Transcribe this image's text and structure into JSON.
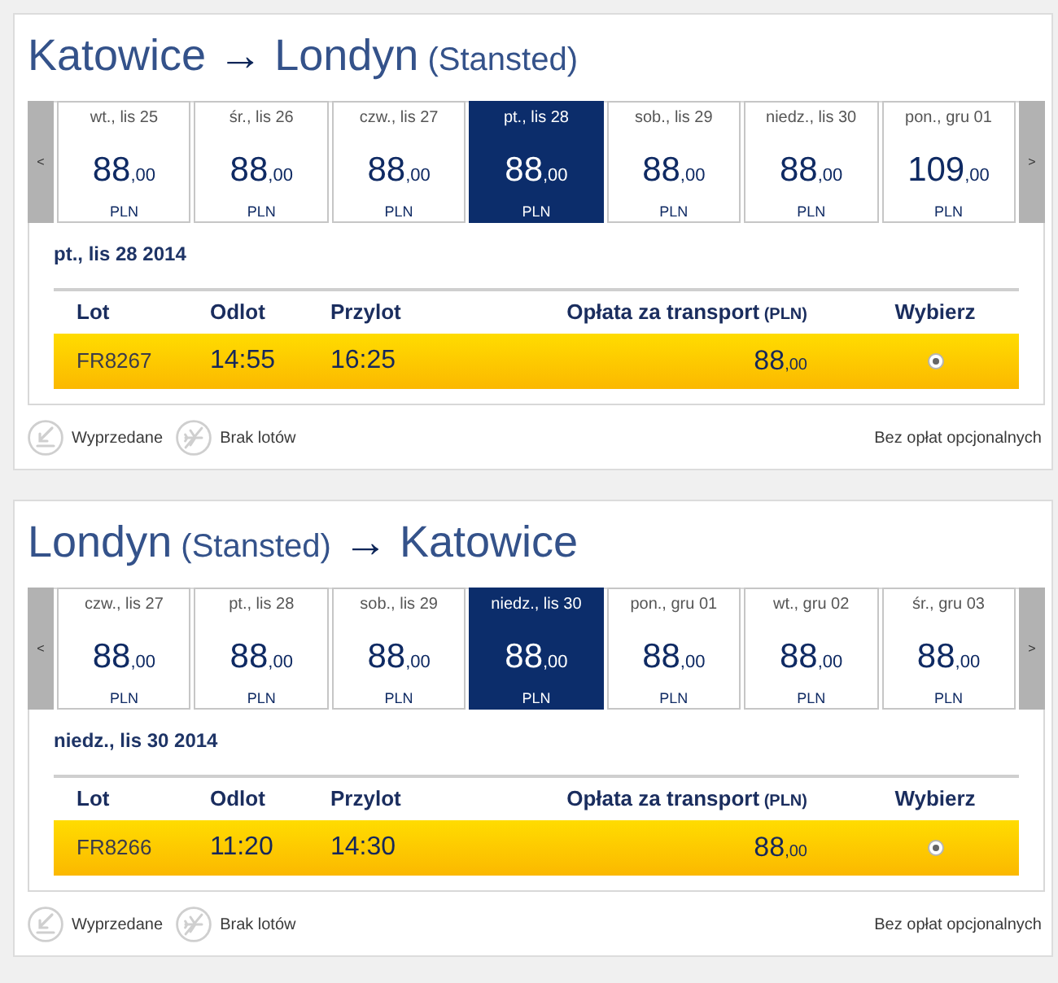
{
  "journeys": [
    {
      "title": [
        {
          "kind": "city",
          "text": "Katowice"
        },
        {
          "kind": "arrow",
          "text": "→"
        },
        {
          "kind": "city",
          "text": "Londyn"
        },
        {
          "kind": "airport",
          "text": "(Stansted)"
        }
      ],
      "prev_button": "<",
      "next_button": ">",
      "dates": [
        {
          "label": "wt., lis 25",
          "price": "88",
          "decimals": ",00",
          "currency": "PLN",
          "selected": false
        },
        {
          "label": "śr., lis 26",
          "price": "88",
          "decimals": ",00",
          "currency": "PLN",
          "selected": false
        },
        {
          "label": "czw., lis 27",
          "price": "88",
          "decimals": ",00",
          "currency": "PLN",
          "selected": false
        },
        {
          "label": "pt., lis 28",
          "price": "88",
          "decimals": ",00",
          "currency": "PLN",
          "selected": true
        },
        {
          "label": "sob., lis 29",
          "price": "88",
          "decimals": ",00",
          "currency": "PLN",
          "selected": false
        },
        {
          "label": "niedz., lis 30",
          "price": "88",
          "decimals": ",00",
          "currency": "PLN",
          "selected": false
        },
        {
          "label": "pon., gru 01",
          "price": "109",
          "decimals": ",00",
          "currency": "PLN",
          "selected": false
        }
      ],
      "selected_date": "pt., lis 28 2014",
      "columns": [
        {
          "label": "Lot"
        },
        {
          "label": "Odlot"
        },
        {
          "label": "Przylot"
        },
        {
          "label": "Opłata za transport",
          "unit": "(PLN)"
        },
        {
          "label": "Wybierz"
        }
      ],
      "rows": [
        {
          "flight": "FR8267",
          "departure": "14:55",
          "arrival": "16:25",
          "price": "88",
          "decimals": ",00",
          "selected": true
        }
      ],
      "legend": [
        {
          "kind": "soldout",
          "label": "Wyprzedane"
        },
        {
          "kind": "noflights",
          "label": "Brak lotów"
        }
      ],
      "note": "Bez opłat opcjonalnych"
    },
    {
      "title": [
        {
          "kind": "city",
          "text": "Londyn"
        },
        {
          "kind": "airport",
          "text": "(Stansted)"
        },
        {
          "kind": "arrow",
          "text": "→"
        },
        {
          "kind": "city",
          "text": "Katowice"
        }
      ],
      "prev_button": "<",
      "next_button": ">",
      "dates": [
        {
          "label": "czw., lis 27",
          "price": "88",
          "decimals": ",00",
          "currency": "PLN",
          "selected": false
        },
        {
          "label": "pt., lis 28",
          "price": "88",
          "decimals": ",00",
          "currency": "PLN",
          "selected": false
        },
        {
          "label": "sob., lis 29",
          "price": "88",
          "decimals": ",00",
          "currency": "PLN",
          "selected": false
        },
        {
          "label": "niedz., lis 30",
          "price": "88",
          "decimals": ",00",
          "currency": "PLN",
          "selected": true
        },
        {
          "label": "pon., gru 01",
          "price": "88",
          "decimals": ",00",
          "currency": "PLN",
          "selected": false
        },
        {
          "label": "wt., gru 02",
          "price": "88",
          "decimals": ",00",
          "currency": "PLN",
          "selected": false
        },
        {
          "label": "śr., gru 03",
          "price": "88",
          "decimals": ",00",
          "currency": "PLN",
          "selected": false
        }
      ],
      "selected_date": "niedz., lis 30 2014",
      "columns": [
        {
          "label": "Lot"
        },
        {
          "label": "Odlot"
        },
        {
          "label": "Przylot"
        },
        {
          "label": "Opłata za transport",
          "unit": "(PLN)"
        },
        {
          "label": "Wybierz"
        }
      ],
      "rows": [
        {
          "flight": "FR8266",
          "departure": "11:20",
          "arrival": "14:30",
          "price": "88",
          "decimals": ",00",
          "selected": true
        }
      ],
      "legend": [
        {
          "kind": "soldout",
          "label": "Wyprzedane"
        },
        {
          "kind": "noflights",
          "label": "Brak lotów"
        }
      ],
      "note": "Bez opłat opcjonalnych"
    }
  ]
}
